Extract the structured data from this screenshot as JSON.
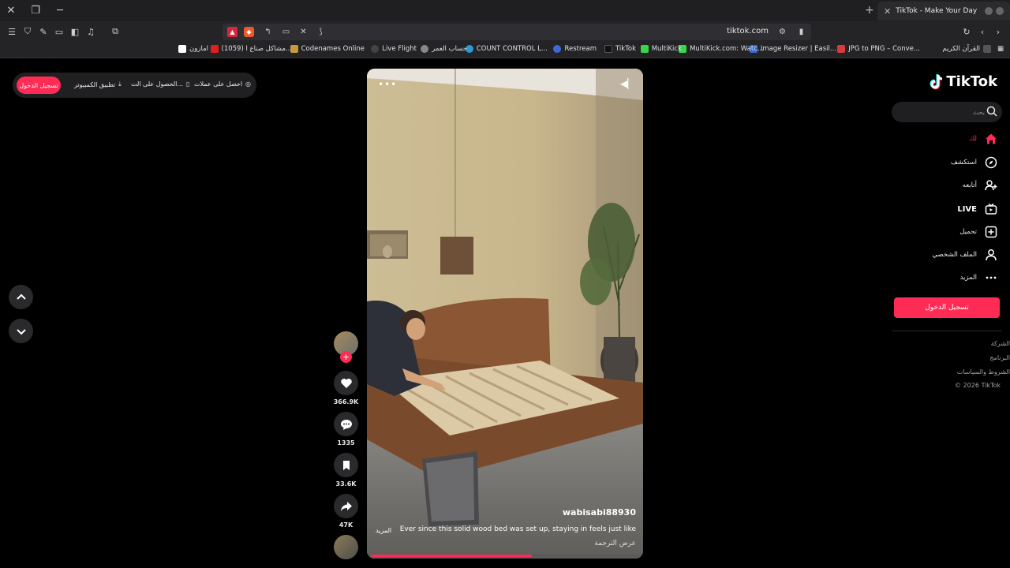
{
  "browser": {
    "tab_title": "TikTok - Make Your Day",
    "url": "tiktok.com",
    "bookmarks": [
      "القرآن الكريم",
      "JPG to PNG – Conve...",
      "Image Resizer | Easil...",
      "MultiKick.com: Watc...",
      "MultiKick",
      "TikTok",
      "Restream",
      "COUNT CONTROL L...",
      "حساب العمر",
      "Live Flight",
      "Codenames Online",
      "(1059) مشاكل صناع ا...",
      "امازون"
    ]
  },
  "topbar": {
    "login": "تسجيل الدخول",
    "desktop_app": "تطبيق الكمبيوتر",
    "get_app": "الحصول على الت...",
    "get_coins": "احصل على عملات"
  },
  "video": {
    "author": "wabisabi88930",
    "caption": "Ever since this solid wood bed was set up, staying in feels just like",
    "more": "المزيد",
    "translate": "عرض الترجمة",
    "progress": 0.6
  },
  "actions": {
    "likes": "366.9K",
    "comments": "1335",
    "saves": "33.6K",
    "shares": "47K"
  },
  "sidebar": {
    "logo": "TikTok",
    "search_placeholder": "بحث",
    "items": [
      {
        "label": "لك",
        "icon": "home-icon"
      },
      {
        "label": "استكشف",
        "icon": "compass-icon"
      },
      {
        "label": "أتابعه",
        "icon": "user-plus-icon"
      },
      {
        "label": "LIVE",
        "icon": "live-tv-icon"
      },
      {
        "label": "تحميل",
        "icon": "upload-plus-icon"
      },
      {
        "label": "الملف الشخصي",
        "icon": "profile-icon"
      },
      {
        "label": "المزيد",
        "icon": "more-dots-icon"
      }
    ],
    "login_button": "تسجيل الدخول",
    "footer": [
      "الشركة",
      "البرنامج",
      "الشروط والسياسات",
      "© 2026 TikTok"
    ]
  },
  "colors": {
    "accent": "#fe2c55",
    "background": "#000000",
    "surface": "#2a2a2c"
  }
}
